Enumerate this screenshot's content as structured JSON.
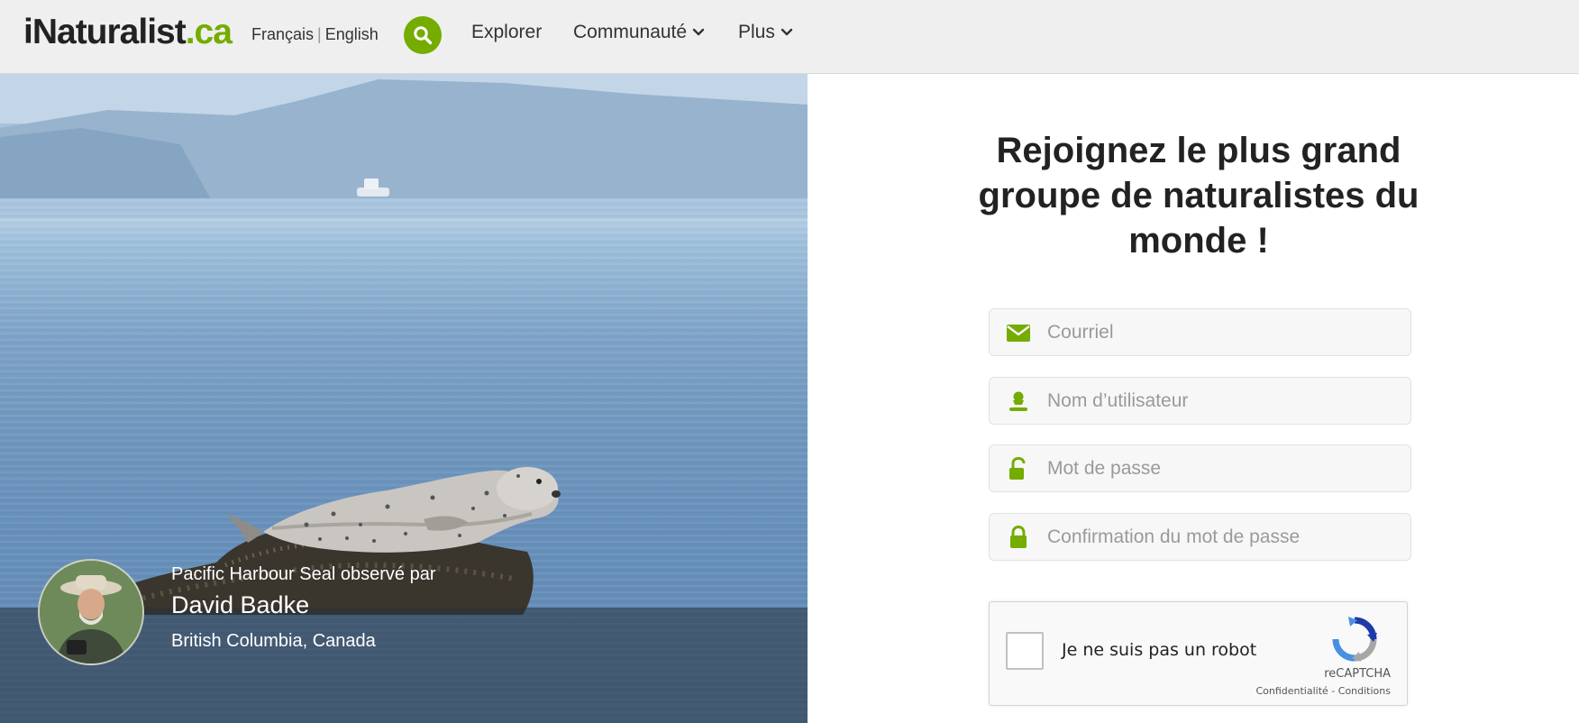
{
  "colors": {
    "brand_green": "#74ac00",
    "header_bg": "#efefef",
    "text_dark": "#222222"
  },
  "header": {
    "logo_main": "iNaturalist",
    "logo_suffix": ".ca",
    "lang_fr": "Français",
    "lang_sep": "|",
    "lang_en": "English",
    "search_icon": "search-icon",
    "nav": {
      "explore": "Explorer",
      "community": "Communauté",
      "more": "Plus"
    }
  },
  "photo": {
    "caption_line": "Pacific Harbour Seal observé par",
    "observer": "David Badke",
    "location": "British Columbia, Canada"
  },
  "signup": {
    "title": "Rejoignez le plus grand groupe de naturalistes du monde !",
    "email_placeholder": "Courriel",
    "username_placeholder": "Nom d’utilisateur",
    "password_placeholder": "Mot de passe",
    "confirm_placeholder": "Confirmation du mot de passe",
    "icons": {
      "email": "envelope-icon",
      "username": "user-icon",
      "password": "unlock-icon",
      "confirm": "lock-icon"
    }
  },
  "captcha": {
    "label": "Je ne suis pas un robot",
    "brand": "reCAPTCHA",
    "privacy": "Confidentialité",
    "link_sep": "-",
    "terms": "Conditions"
  }
}
